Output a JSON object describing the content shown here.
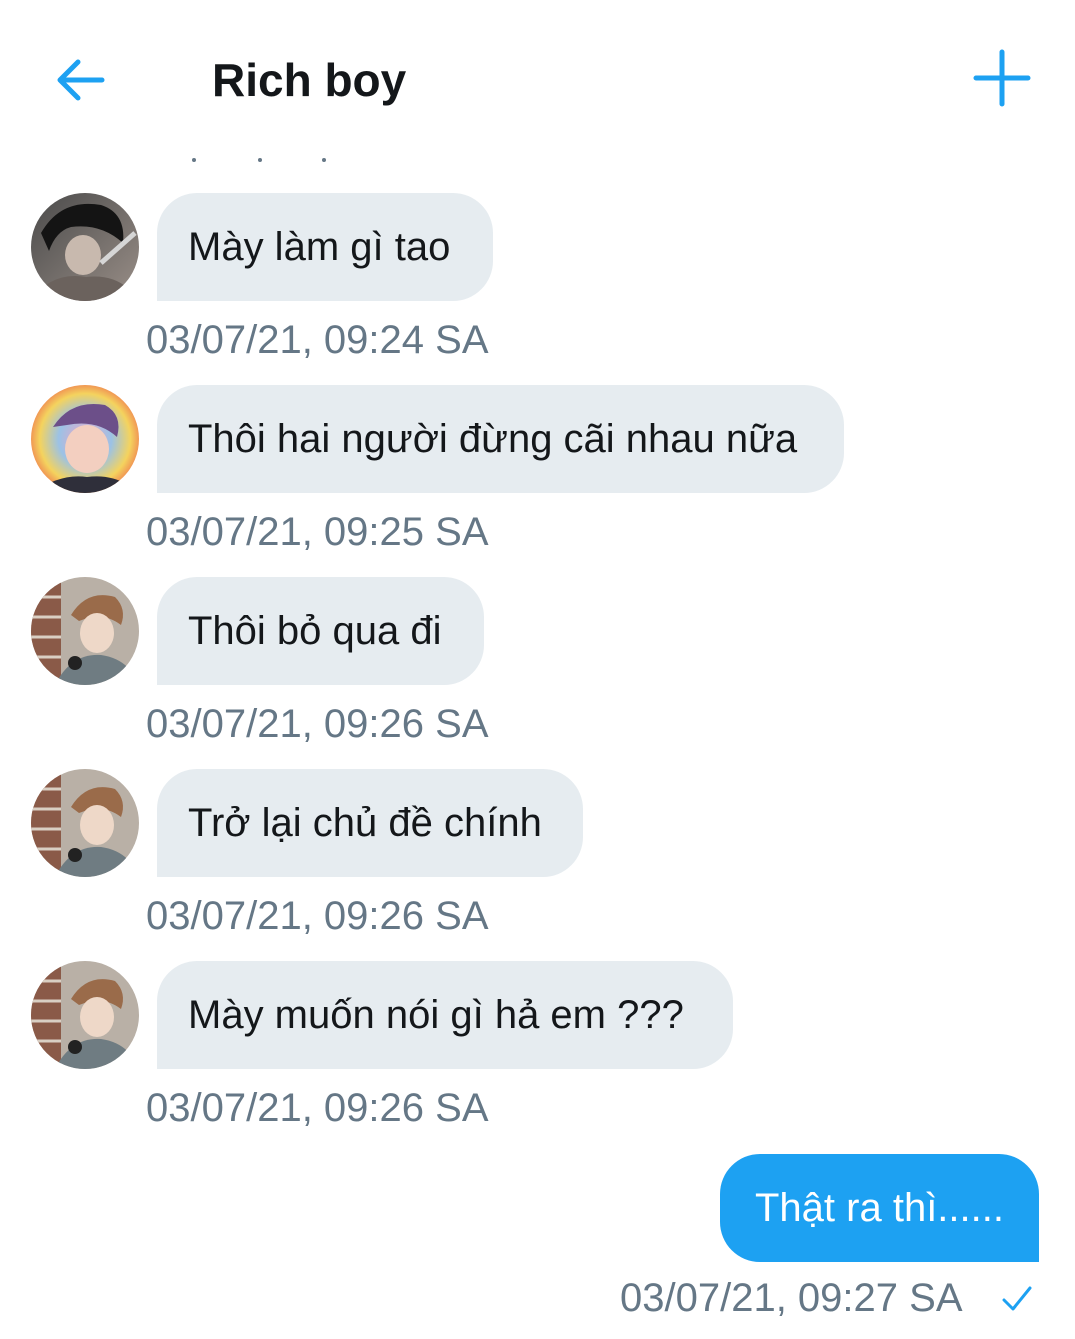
{
  "header": {
    "title": "Rich boy",
    "back_icon": "arrow-left-icon",
    "add_icon": "plus-icon",
    "accent_color": "#1da1f2"
  },
  "messages": [
    {
      "text": "Mày làm gì tao",
      "timestamp": "03/07/21, 09:24 SA"
    },
    {
      "text": "Thôi hai người đừng cãi nhau nữa",
      "timestamp": "03/07/21, 09:25 SA"
    },
    {
      "text": "Thôi bỏ qua đi",
      "timestamp": "03/07/21, 09:26 SA"
    },
    {
      "text": "Trở lại chủ đề chính",
      "timestamp": "03/07/21, 09:26 SA"
    },
    {
      "text": "Mày muốn nói gì hả em ???",
      "timestamp": "03/07/21, 09:26 SA"
    }
  ],
  "outgoing": {
    "text": "Thật ra thì......",
    "timestamp": "03/07/21, 09:27 SA",
    "status_icon": "check-icon"
  },
  "colors": {
    "incoming_bubble": "#e6ecf0",
    "outgoing_bubble": "#1da1f2",
    "timestamp": "#657786"
  }
}
